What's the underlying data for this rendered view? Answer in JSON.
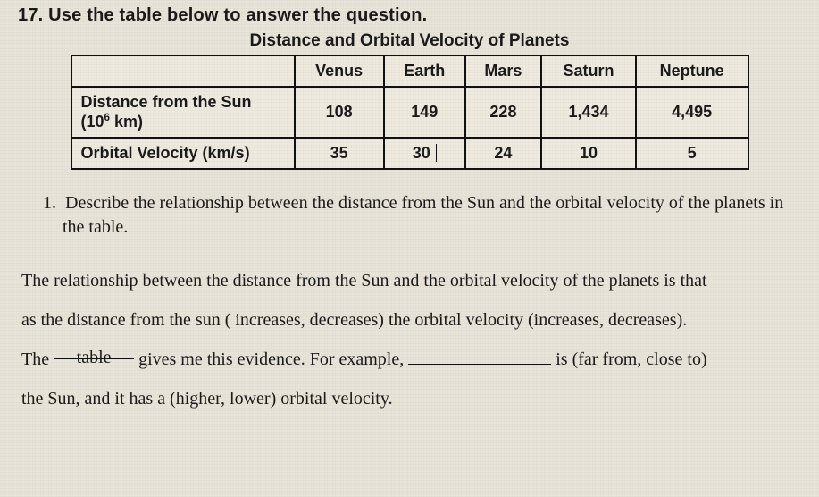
{
  "question_heading": "17.  Use the table below to answer the question.",
  "table_title": "Distance and Orbital Velocity of Planets",
  "table": {
    "col_headers": [
      "Venus",
      "Earth",
      "Mars",
      "Saturn",
      "Neptune"
    ],
    "rows": [
      {
        "label_html": "Distance from the Sun (10⁶ km)",
        "values": [
          "108",
          "149",
          "228",
          "1,434",
          "4,495"
        ]
      },
      {
        "label_html": "Orbital Velocity (km/s)",
        "values": [
          "35",
          "30",
          "24",
          "10",
          "5"
        ]
      }
    ]
  },
  "subq": {
    "num": "1.",
    "text": "Describe the relationship between the distance from the Sun and the orbital velocity of the planets in the table."
  },
  "fill": {
    "line1": "The relationship between the distance from the Sun and the orbital velocity of the planets is that",
    "line2a": "as the distance from the sun ( increases, decreases)  the orbital velocity (increases, decreases).",
    "line3_pre": "The ",
    "blank1_value": "table",
    "line3_mid": " gives me this evidence.  For example, ",
    "line3_post": " is (far from, close to)",
    "line4": "the Sun, and it has a (higher, lower) orbital velocity."
  },
  "chart_data": {
    "type": "table",
    "title": "Distance and Orbital Velocity of Planets",
    "categories": [
      "Venus",
      "Earth",
      "Mars",
      "Saturn",
      "Neptune"
    ],
    "series": [
      {
        "name": "Distance from the Sun (10^6 km)",
        "values": [
          108,
          149,
          228,
          1434,
          4495
        ]
      },
      {
        "name": "Orbital Velocity (km/s)",
        "values": [
          35,
          30,
          24,
          10,
          5
        ]
      }
    ]
  }
}
